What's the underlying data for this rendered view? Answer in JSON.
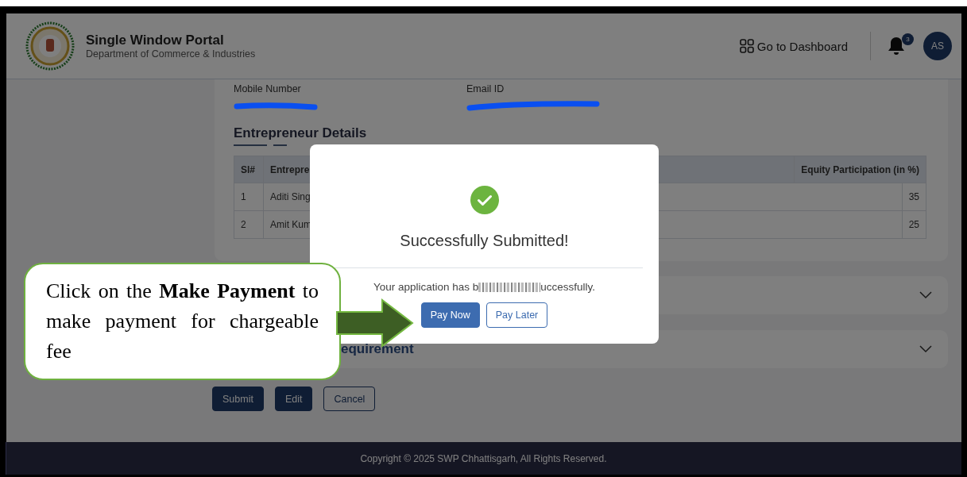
{
  "header": {
    "title": "Single Window Portal",
    "subtitle": "Department of Commerce & Industries",
    "dashboard_link": "Go to Dashboard",
    "notification_count": "3",
    "avatar_initials": "AS"
  },
  "contact_fields": [
    {
      "label": "Mobile Number",
      "redacted": true
    },
    {
      "label": "Email ID",
      "redacted": true
    }
  ],
  "section_title": "Entrepreneur Details",
  "table": {
    "columns": [
      "Sl#",
      "Entrepre",
      "Equity Participation (in %)"
    ],
    "rows": [
      [
        "1",
        "Aditi Sing",
        "35"
      ],
      [
        "2",
        "Amit Kum",
        "25"
      ]
    ]
  },
  "accordions": [
    {
      "expanded": false
    },
    {
      "title": "equirement",
      "expanded": false
    }
  ],
  "form_buttons": [
    {
      "label": "Submit",
      "kind": "primary"
    },
    {
      "label": "Edit",
      "kind": "primary"
    },
    {
      "label": "Cancel",
      "kind": "outline"
    }
  ],
  "footer": {
    "copyright": "Copyright © 2025 SWP Chhattisgarh, All Rights Reserved."
  },
  "modal": {
    "title": "Successfully Submitted!",
    "message_start": "Your application has b",
    "message_end": "uccessfully.",
    "buttons": [
      {
        "label": "Pay Now",
        "kind": "primary"
      },
      {
        "label": "Pay Later",
        "kind": "outline"
      }
    ]
  },
  "callout": {
    "text": "Click on the **Make Payment** to make payment for chargeable fee"
  }
}
